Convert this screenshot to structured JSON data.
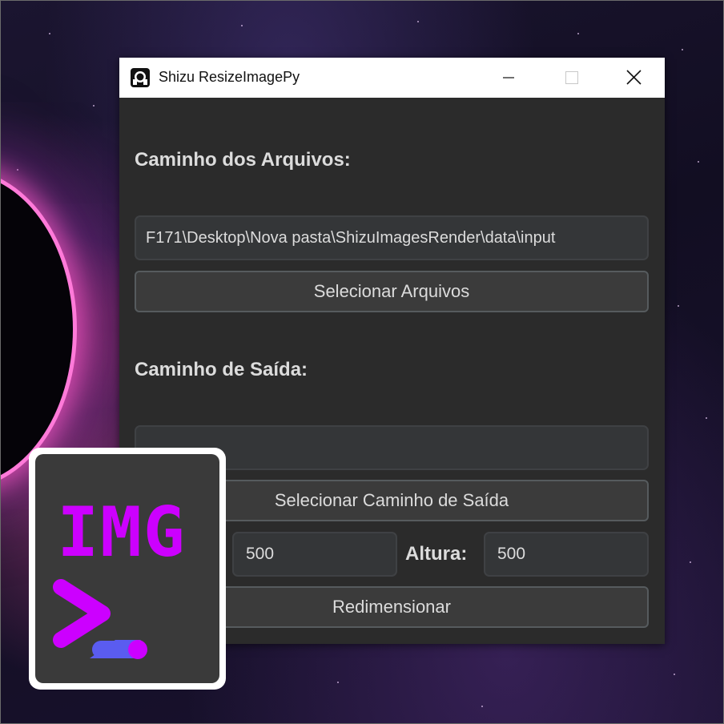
{
  "window": {
    "title": "Shizu ResizeImagePy",
    "controls": [
      "minimize",
      "maximize",
      "close"
    ]
  },
  "input_section": {
    "title": "Caminho dos Arquivos:",
    "path_value": "F171\\Desktop\\Nova pasta\\ShizuImagesRender\\data\\input",
    "select_button": "Selecionar Arquivos"
  },
  "output_section": {
    "title": "Caminho de Saída:",
    "path_value": "",
    "select_button": "Selecionar Caminho de Saída"
  },
  "size": {
    "width_value": "500",
    "height_label": "Altura:",
    "height_value": "500"
  },
  "resize_button": "Redimensionar",
  "logo": {
    "text": "IMG",
    "accent_color": "#cc00ff",
    "secondary_color": "#5a5cf0"
  },
  "colors": {
    "window_bg": "#2b2b2b",
    "field_bg": "#343638",
    "button_bg": "#3b3b3b",
    "text": "#dcdcdc"
  }
}
